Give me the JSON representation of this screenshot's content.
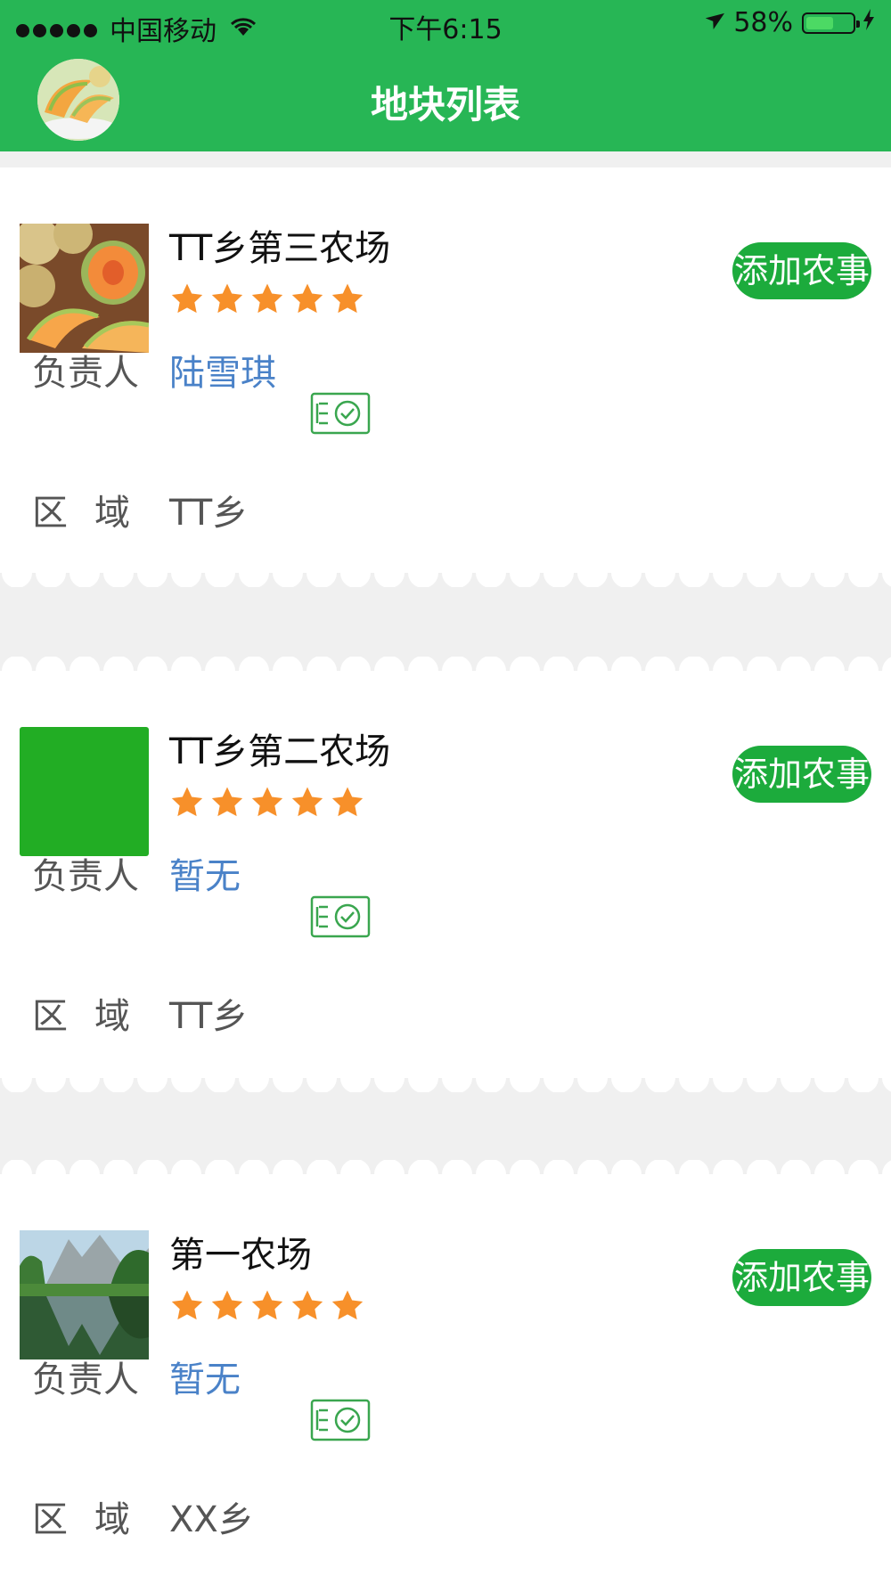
{
  "status_bar": {
    "carrier": "中国移动",
    "time": "下午6:15",
    "battery": "58%"
  },
  "header": {
    "title": "地块列表",
    "avatar_icon": "melon-avatar-icon"
  },
  "labels": {
    "manager": "负责人",
    "area": "区域"
  },
  "colors": {
    "header_green": "#27b655",
    "button_green": "#1cab3c",
    "star_orange": "#f7902a",
    "link_blue": "#4a82c8"
  },
  "farms": [
    {
      "name": "TT乡第三农场",
      "rating": 5,
      "manager": "陆雪琪",
      "region": "TT乡",
      "add_button": "添加农事",
      "thumbnail": "melon-photo"
    },
    {
      "name": "TT乡第二农场",
      "rating": 5,
      "manager": "暂无",
      "region": "TT乡",
      "add_button": "添加农事",
      "thumbnail": "green-placeholder"
    },
    {
      "name": "第一农场",
      "rating": 5,
      "manager": "暂无",
      "region": "XX乡",
      "add_button": "添加农事",
      "thumbnail": "lake-landscape-photo"
    }
  ]
}
